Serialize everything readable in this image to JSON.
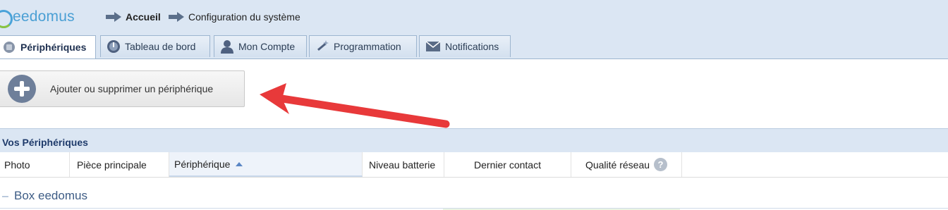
{
  "header": {
    "brand": "eedomus",
    "breadcrumb": [
      {
        "label": "Accueil",
        "icon": "arrow-right-icon"
      },
      {
        "label": "Configuration du système",
        "icon": "arrow-right-icon"
      }
    ]
  },
  "tabs": [
    {
      "label": "Périphériques",
      "icon": "devices-icon",
      "active": true
    },
    {
      "label": "Tableau de bord",
      "icon": "dashboard-icon",
      "active": false
    },
    {
      "label": "Mon Compte",
      "icon": "user-icon",
      "active": false
    },
    {
      "label": "Programmation",
      "icon": "magic-wand-icon",
      "active": false
    },
    {
      "label": "Notifications",
      "icon": "envelope-icon",
      "active": false
    }
  ],
  "toolbar": {
    "add_button_label": "Ajouter ou supprimer un périphérique",
    "add_button_icon": "plus-circle-icon"
  },
  "annotation": {
    "arrow_color": "#e8393a"
  },
  "section": {
    "title": "Vos Périphériques"
  },
  "table": {
    "columns": [
      {
        "label": "Photo"
      },
      {
        "label": "Pièce principale"
      },
      {
        "label": "Périphérique",
        "sort": "ascending"
      },
      {
        "label": "Niveau batterie"
      },
      {
        "label": "Dernier contact"
      },
      {
        "label": "Qualité réseau",
        "help_icon": "?"
      }
    ],
    "groups": [
      {
        "toggle": "–",
        "label": "Box eedomus"
      }
    ]
  },
  "colors": {
    "header_bg": "#dbe6f3",
    "brand_blue": "#4a9fd4",
    "section_title": "#1f3b6b"
  }
}
